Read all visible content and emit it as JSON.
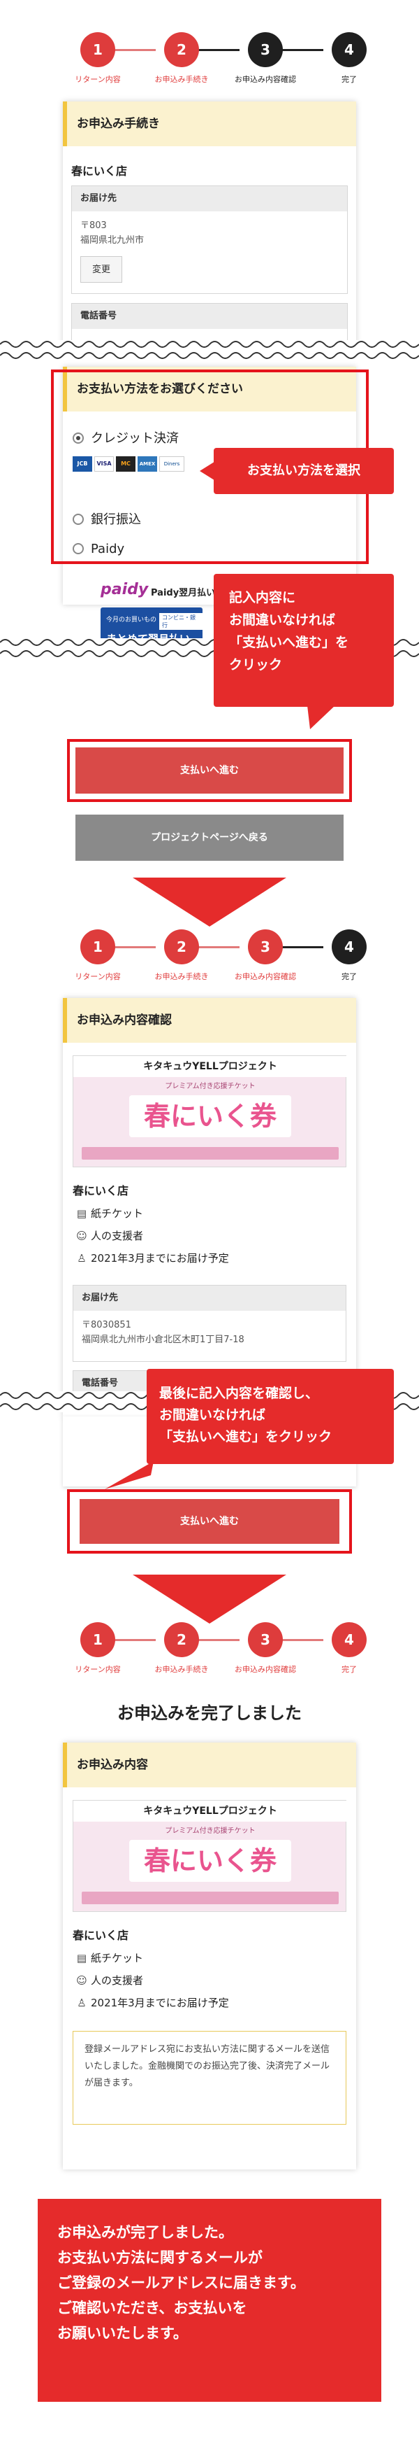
{
  "steps": {
    "labels": [
      "リターン内容",
      "お申込み手続き",
      "お申込み内容確認",
      "完了"
    ],
    "numbers": [
      "1",
      "2",
      "3",
      "4"
    ]
  },
  "section1": {
    "card_title": "お申込み手続き",
    "store_name": "春にいく店",
    "delivery_label": "お届け先",
    "postal": "〒803",
    "address": "福岡県北九州市",
    "change_button": "変更",
    "phone_label": "電話番号",
    "payment_title": "お支払い方法をお選びください",
    "options": [
      "クレジット決済",
      "銀行振込",
      "Paidy"
    ],
    "card_brands": [
      "JCB",
      "VISA",
      "MC",
      "AMEX",
      "Diners"
    ],
    "paidy_logo": "paidy",
    "paidy_desc": "Paidy翌月払い(コンビニ/銀行)",
    "paidy_banner_small": "今月のお買いもの",
    "paidy_banner_tag": "コンビニ・銀行",
    "paidy_banner_big": "まとめて翌月払い",
    "callout_select": "お支払い方法を選択",
    "callout_proceed": "記入内容に\nお間違いなければ\n「支払いへ進む」を\nクリック",
    "proceed_button": "支払いへ進む",
    "back_button": "プロジェクトページへ戻る"
  },
  "section2": {
    "card_title": "お申込み内容確認",
    "banner_top": "キタキュウYELLプロジェクト",
    "banner_sub": "プレミアム付き応援チケット",
    "banner_main": "春にいく券",
    "store_name": "春にいく店",
    "ticket": "紙チケット",
    "supporters": "人の支援者",
    "delivery_date": "2021年3月までにお届け予定",
    "delivery_label": "お届け先",
    "postal": "〒8030851",
    "address": "福岡県北九州市小倉北区木町1丁目7-18",
    "phone_label": "電話番号",
    "callout": "最後に記入内容を確認し、\nお間違いなければ\n「支払いへ進む」をクリック",
    "proceed_button": "支払いへ進む"
  },
  "section3": {
    "complete_title": "お申込みを完了しました",
    "card_title": "お申込み内容",
    "banner_top": "キタキュウYELLプロジェクト",
    "banner_sub": "プレミアム付き応援チケット",
    "banner_main": "春にいく券",
    "store_name": "春にいく店",
    "ticket": "紙チケット",
    "supporters": "人の支援者",
    "delivery_date": "2021年3月までにお届け予定",
    "notice": "登録メールアドレス宛にお支払い方法に関するメールを送信いたしました。金融機関でのお振込完了後、決済完了メールが届きます。",
    "final_callout": "お申込みが完了しました。\nお支払い方法に関するメールが\nご登録のメールアドレスに届きます。\nご確認いただき、お支払いを\nお願いいたします。"
  },
  "colors": {
    "accent_red": "#de3c3c",
    "callout_red": "#e52b2b",
    "header_yellow": "#fbf2cf",
    "paidy_purple": "#a52f96",
    "paidy_blue": "#1c4fa1"
  }
}
